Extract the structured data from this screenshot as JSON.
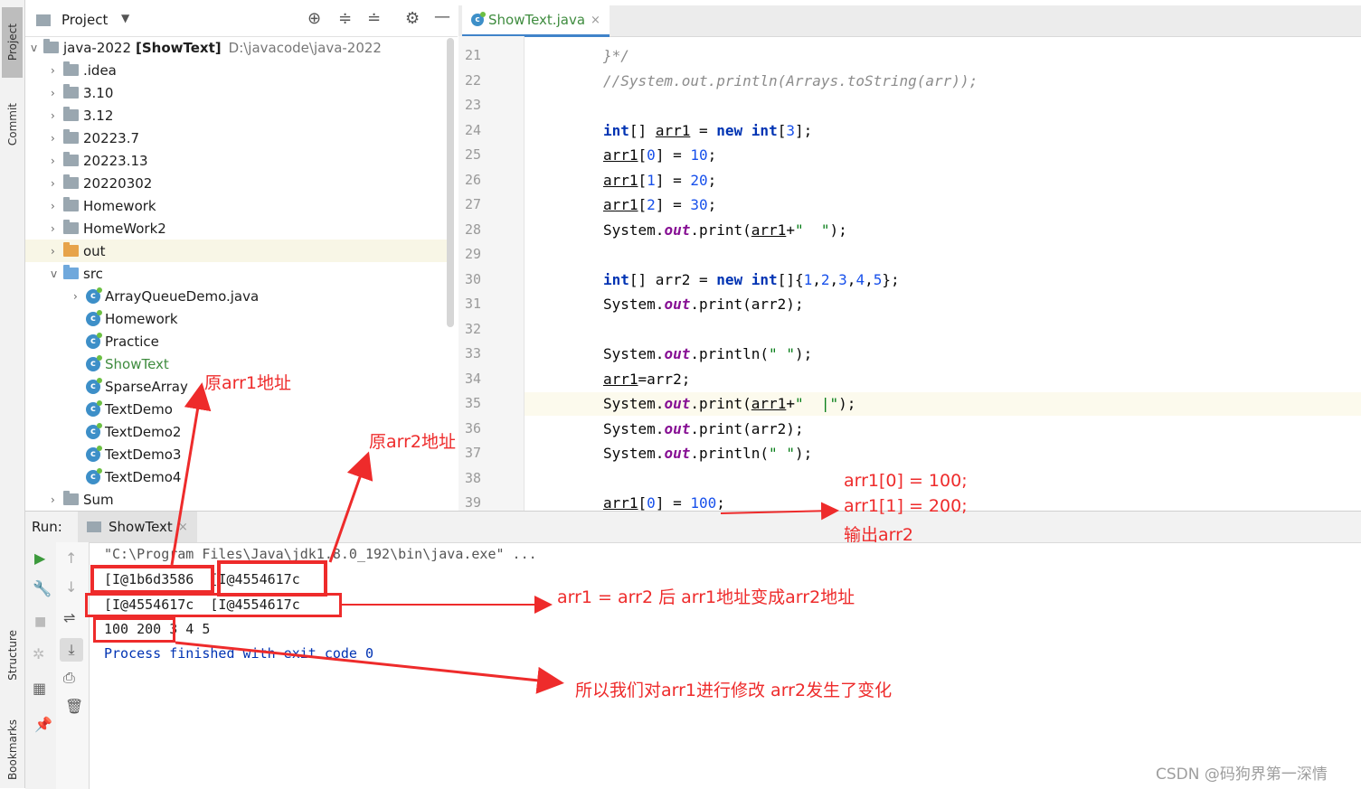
{
  "left_strip": {
    "project": "Project",
    "commit": "Commit",
    "structure": "Structure",
    "bookmarks": "Bookmarks"
  },
  "project_panel": {
    "title": "Project",
    "root": {
      "name": "java-2022",
      "module": "[ShowText]",
      "path": "D:\\javacode\\java-2022"
    },
    "folders": [
      ".idea",
      "3.10",
      "3.12",
      "20223.7",
      "20223.13",
      "20220302",
      "Homework",
      "HomeWork2"
    ],
    "out_folder": "out",
    "src_folder": "src",
    "src_files": [
      "ArrayQueueDemo.java",
      "Homework",
      "Practice",
      "ShowText",
      "SparseArray",
      "TextDemo",
      "TextDemo2",
      "TextDemo3",
      "TextDemo4"
    ],
    "last_folder": "Sum"
  },
  "editor": {
    "tab": "ShowText.java",
    "lines": [
      "21",
      "22",
      "23",
      "24",
      "25",
      "26",
      "27",
      "28",
      "29",
      "30",
      "31",
      "32",
      "33",
      "34",
      "35",
      "36",
      "37",
      "38",
      "39"
    ]
  },
  "run_panel": {
    "label": "Run:",
    "tab": "ShowText",
    "console": [
      "\"C:\\Program Files\\Java\\jdk1.8.0_192\\bin\\java.exe\" ...",
      "[I@1b6d3586  [I@4554617c",
      "[I@4554617c  [I@4554617c",
      "100 200 3 4 5",
      "Process finished with exit code 0"
    ]
  },
  "annotations": {
    "orig_arr1": "原arr1地址",
    "orig_arr2": "原arr2地址",
    "arr_assign_1": "arr1[0] = 100;",
    "arr_assign_2": "arr1[1] = 200;",
    "arr_assign_3": "输出arr2",
    "after_assign": "arr1 = arr2 后 arr1地址变成arr2地址",
    "conclusion": "所以我们对arr1进行修改 arr2发生了变化"
  },
  "watermark": "CSDN @码狗界第一深情",
  "colors": {
    "annotation_red": "#ee2b2b",
    "keyword_blue": "#0033b3",
    "number_blue": "#1750eb",
    "static_purple": "#871094"
  }
}
